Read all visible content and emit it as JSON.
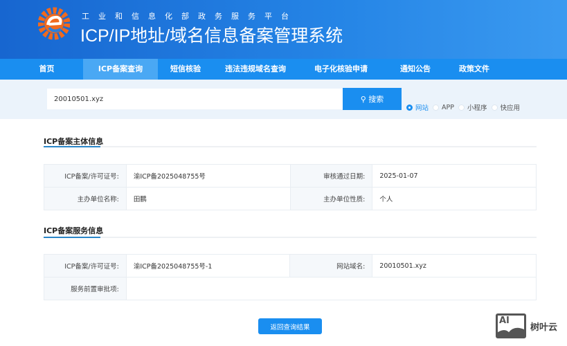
{
  "header": {
    "subtitle": "工业和信息化部政务服务平台",
    "title": "ICP/IP地址/域名信息备案管理系统"
  },
  "nav": [
    "首页",
    "ICP备案查询",
    "短信核验",
    "违法违规域名查询",
    "电子化核验申请",
    "通知公告",
    "政策文件"
  ],
  "search": {
    "value": "20010501.xyz",
    "button": "搜索",
    "types": [
      "网站",
      "APP",
      "小程序",
      "快应用"
    ],
    "selected": "网站"
  },
  "subject": {
    "title": "ICP备案主体信息",
    "rows": [
      {
        "l1": "ICP备案/许可证号:",
        "v1": "渝ICP备2025048755号",
        "l2": "审核通过日期:",
        "v2": "2025-01-07"
      },
      {
        "l1": "主办单位名称:",
        "v1": "田鹏",
        "l2": "主办单位性质:",
        "v2": "个人"
      }
    ]
  },
  "service": {
    "title": "ICP备案服务信息",
    "rows": [
      {
        "l1": "ICP备案/许可证号:",
        "v1": "渝ICP备2025048755号-1",
        "l2": "网站域名:",
        "v2": "20010501.xyz"
      },
      {
        "l1": "服务前置审批项:",
        "v1": ""
      }
    ]
  },
  "back_button": "返回查询结果",
  "watermark": {
    "logo": "AI",
    "text": "树叶云"
  }
}
